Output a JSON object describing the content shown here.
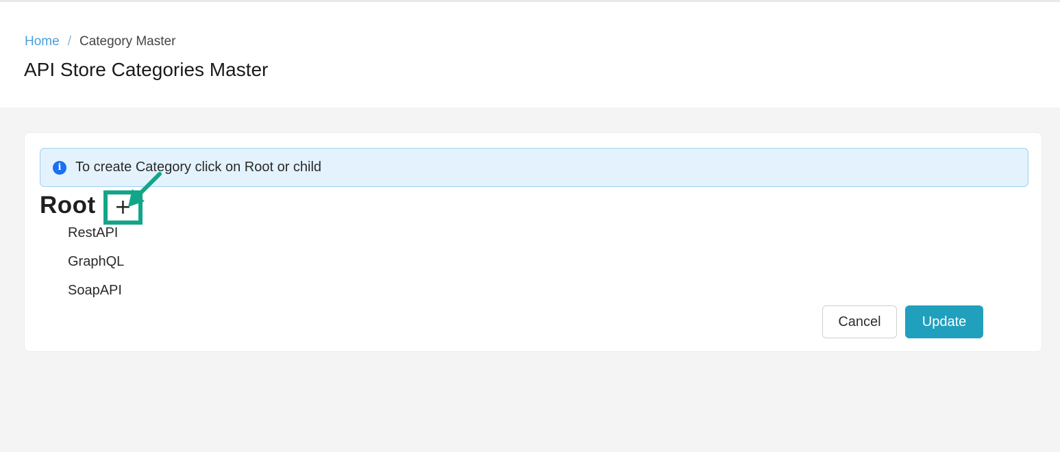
{
  "breadcrumb": {
    "home": "Home",
    "separator": "/",
    "current": "Category Master"
  },
  "page": {
    "title": "API Store Categories Master"
  },
  "alert": {
    "icon": "info-icon",
    "text": "To create Category click on Root or child"
  },
  "tree": {
    "root_label": "Root",
    "add_icon": "plus-icon",
    "add_symbol": "+",
    "children": [
      "RestAPI",
      "GraphQL",
      "SoapAPI"
    ]
  },
  "actions": {
    "cancel_label": "Cancel",
    "update_label": "Update"
  },
  "colors": {
    "link": "#4a9fd8",
    "highlight": "#13a58a",
    "primary_button": "#20a0bd",
    "alert_bg": "#e3f2fd"
  }
}
